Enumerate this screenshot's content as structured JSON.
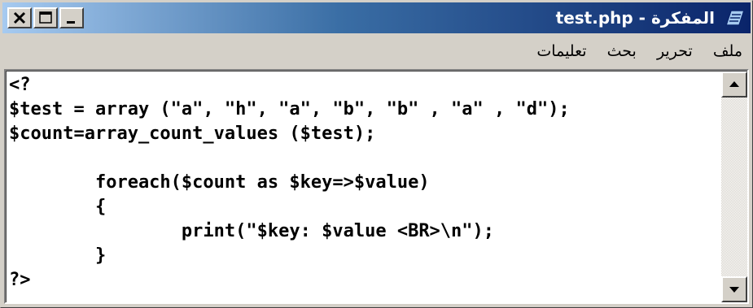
{
  "window": {
    "title": "test.php - المفكرة"
  },
  "menu": {
    "items": [
      "ملف",
      "تحرير",
      "بحث",
      "تعليمات"
    ]
  },
  "editor": {
    "content": "<?\n$test = array (\"a\", \"h\", \"a\", \"b\", \"b\" , \"a\" , \"d\");\n$count=array_count_values ($test);\n\n        foreach($count as $key=>$value)\n        {\n                print(\"$key: $value <BR>\\n\");\n        }\n?>"
  },
  "icons": {
    "app": "notepad-icon",
    "close": "close-icon",
    "maximize": "maximize-icon",
    "minimize": "minimize-icon",
    "scroll_up": "scroll-up-arrow-icon",
    "scroll_down": "scroll-down-arrow-icon"
  },
  "colors": {
    "title_start": "#0a246a",
    "title_end": "#a6caf0",
    "face": "#d4d0c8"
  }
}
